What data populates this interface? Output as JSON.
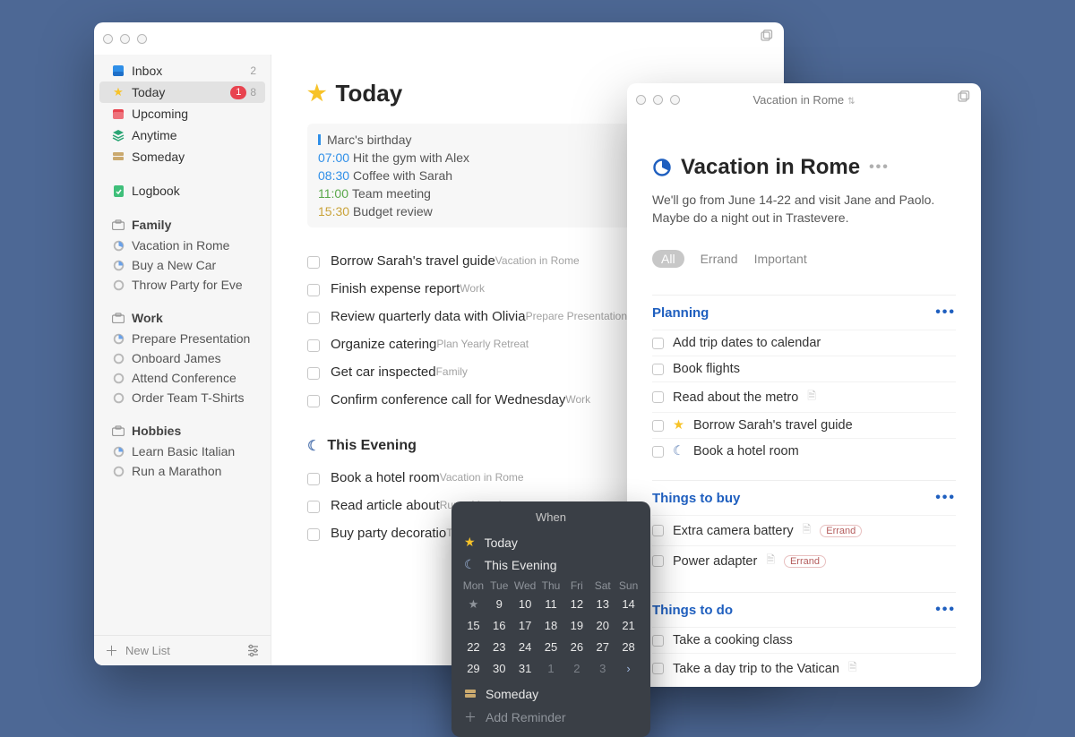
{
  "sidebar": {
    "inbox": {
      "label": "Inbox",
      "count": "2"
    },
    "today": {
      "label": "Today",
      "badge": "1",
      "count": "8"
    },
    "upcoming": {
      "label": "Upcoming"
    },
    "anytime": {
      "label": "Anytime"
    },
    "someday": {
      "label": "Someday"
    },
    "logbook": {
      "label": "Logbook"
    },
    "areas": [
      {
        "name": "Family",
        "projects": [
          {
            "name": "Vacation in Rome"
          },
          {
            "name": "Buy a New Car"
          },
          {
            "name": "Throw Party for Eve"
          }
        ]
      },
      {
        "name": "Work",
        "projects": [
          {
            "name": "Prepare Presentation"
          },
          {
            "name": "Onboard James"
          },
          {
            "name": "Attend Conference"
          },
          {
            "name": "Order Team T-Shirts"
          }
        ]
      },
      {
        "name": "Hobbies",
        "projects": [
          {
            "name": "Learn Basic Italian"
          },
          {
            "name": "Run a Marathon"
          }
        ]
      }
    ],
    "newList": "New List"
  },
  "today": {
    "title": "Today",
    "agenda": [
      {
        "time": "",
        "label": "Marc's birthday",
        "color": "bar"
      },
      {
        "time": "07:00",
        "label": "Hit the gym with Alex",
        "color": "blue"
      },
      {
        "time": "08:30",
        "label": "Coffee with Sarah",
        "color": "blue"
      },
      {
        "time": "11:00",
        "label": "Team meeting",
        "color": "green"
      },
      {
        "time": "15:30",
        "label": "Budget review",
        "color": "amber"
      }
    ],
    "tasks": [
      {
        "title": "Borrow Sarah's travel guide",
        "sub": "Vacation in Rome"
      },
      {
        "title": "Finish expense report",
        "sub": "Work"
      },
      {
        "title": "Review quarterly data with Olivia",
        "sub": "Prepare Presentation"
      },
      {
        "title": "Organize catering",
        "sub": "Plan Yearly Retreat"
      },
      {
        "title": "Get car inspected",
        "sub": "Family"
      },
      {
        "title": "Confirm conference call for Wednesday",
        "sub": "Work"
      }
    ],
    "eveningTitle": "This Evening",
    "evening": [
      {
        "title": "Book a hotel room",
        "sub": "Vacation in Rome"
      },
      {
        "title": "Read article about",
        "sub": "Run a Marathon"
      },
      {
        "title": "Buy party decoratio",
        "sub": "Throw Party for Eve"
      }
    ]
  },
  "when": {
    "title": "When",
    "today": "Today",
    "evening": "This Evening",
    "someday": "Someday",
    "addReminder": "Add Reminder",
    "dow": [
      "Mon",
      "Tue",
      "Wed",
      "Thu",
      "Fri",
      "Sat",
      "Sun"
    ],
    "weeks": [
      [
        "★",
        "9",
        "10",
        "11",
        "12",
        "13",
        "14"
      ],
      [
        "15",
        "16",
        "17",
        "18",
        "19",
        "20",
        "21"
      ],
      [
        "22",
        "23",
        "24",
        "25",
        "26",
        "27",
        "28"
      ],
      [
        "29",
        "30",
        "31",
        "1",
        "2",
        "3",
        "›"
      ]
    ]
  },
  "project": {
    "windowTitle": "Vacation in Rome",
    "title": "Vacation in Rome",
    "description": "We'll go from June 14-22 and visit Jane and Paolo. Maybe do a night out in Trastevere.",
    "tags": {
      "all": "All",
      "errand": "Errand",
      "important": "Important"
    },
    "sections": [
      {
        "name": "Planning",
        "tasks": [
          {
            "title": "Add trip dates to calendar"
          },
          {
            "title": "Book flights"
          },
          {
            "title": "Read about the metro",
            "note": true
          },
          {
            "title": "Borrow Sarah's travel guide",
            "star": true
          },
          {
            "title": "Book a hotel room",
            "moon": true
          }
        ]
      },
      {
        "name": "Things to buy",
        "tasks": [
          {
            "title": "Extra camera battery",
            "note": true,
            "tag": "Errand"
          },
          {
            "title": "Power adapter",
            "note": true,
            "tag": "Errand"
          }
        ]
      },
      {
        "name": "Things to do",
        "tasks": [
          {
            "title": "Take a cooking class"
          },
          {
            "title": "Take a day trip to the Vatican",
            "note": true
          }
        ]
      }
    ]
  }
}
